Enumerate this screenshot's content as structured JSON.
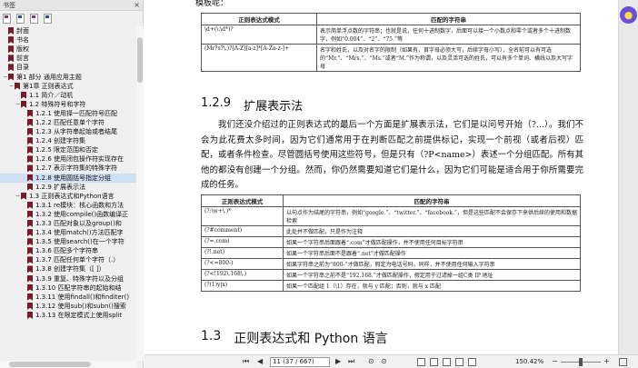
{
  "sidebar": {
    "title": "书签",
    "close": "×",
    "items": [
      {
        "label": "封面",
        "level": 0,
        "tw": ""
      },
      {
        "label": "书名",
        "level": 0,
        "tw": ""
      },
      {
        "label": "版权",
        "level": 0,
        "tw": ""
      },
      {
        "label": "前言",
        "level": 0,
        "tw": ""
      },
      {
        "label": "目录",
        "level": 0,
        "tw": ""
      },
      {
        "label": "第1 部分 通用应用主题",
        "level": 0,
        "tw": "−"
      },
      {
        "label": "第1章 正则表达式",
        "level": 1,
        "tw": "−"
      },
      {
        "label": "1.1 简介／动机",
        "level": 2,
        "tw": ""
      },
      {
        "label": "1.2 特殊符号和字符",
        "level": 2,
        "tw": "−"
      },
      {
        "label": "1.2.1 使用择一匹配符号匹配",
        "level": 3,
        "tw": ""
      },
      {
        "label": "1.2.2 匹配任意单个字符",
        "level": 3,
        "tw": ""
      },
      {
        "label": "1.2.3 从字符串起始或者结尾",
        "level": 3,
        "tw": ""
      },
      {
        "label": "1.2.4 创建字符集",
        "level": 3,
        "tw": ""
      },
      {
        "label": "1.2.5 限定范围和否定",
        "level": 3,
        "tw": ""
      },
      {
        "label": "1.2.6 使用闭包操作符实现存在",
        "level": 3,
        "tw": ""
      },
      {
        "label": "1.2.7 表示字符集的特殊字符",
        "level": 3,
        "tw": ""
      },
      {
        "label": "1.2.8 使用圆括号指定分组",
        "level": 3,
        "tw": "",
        "sel": true
      },
      {
        "label": "1.2.9 扩展表示法",
        "level": 3,
        "tw": ""
      },
      {
        "label": "1.3 正则表达式和Python语言",
        "level": 2,
        "tw": "−"
      },
      {
        "label": "1.3.1 re模块：核心函数和方法",
        "level": 3,
        "tw": ""
      },
      {
        "label": "1.3.2 使用compile()函数编译正",
        "level": 3,
        "tw": ""
      },
      {
        "label": "1.3.3 匹配对象以及group()和",
        "level": 3,
        "tw": ""
      },
      {
        "label": "1.3.4 使用match()方法匹配字",
        "level": 3,
        "tw": ""
      },
      {
        "label": "1.3.5 使用search()在一个字符",
        "level": 3,
        "tw": ""
      },
      {
        "label": "1.3.6 匹配多个字符串",
        "level": 3,
        "tw": ""
      },
      {
        "label": "1.3.7 匹配任何单个字符（.）",
        "level": 3,
        "tw": ""
      },
      {
        "label": "1.3.8 创建字符集（[ ]）",
        "level": 3,
        "tw": ""
      },
      {
        "label": "1.3.9 重复、特殊字符以及分组",
        "level": 3,
        "tw": ""
      },
      {
        "label": "1.3.10 匹配字符串的起始和结",
        "level": 3,
        "tw": ""
      },
      {
        "label": "1.3.11 使用findall()和finditer()",
        "level": 3,
        "tw": ""
      },
      {
        "label": "1.3.12 使用sub()和subn()搜索",
        "level": 3,
        "tw": ""
      },
      {
        "label": "1.3.13 在限定模式上使用split",
        "level": 3,
        "tw": ""
      }
    ]
  },
  "page": {
    "cut_text": "模板呢：",
    "table1": {
      "headers": [
        "正则表达式模式",
        "匹配的字符串"
      ],
      "rows": [
        [
          "\\d+(\\.\\d*)?",
          "表示简单浮点数的字符串；也就是说，任何十进制数字，后面可以接一个小数点和零个或者多个十进制数字，例如“0.004”、“2”、“75.”等"
        ],
        [
          "(Mr?s?\\.)?[A-Z][a-z]*[A-Za-z-]+",
          "名字和姓氏，以及对名字的限制（如果有，首字母必须大写，后续字母小写），全名前可以有可选的“Mr.”、“Mrs.”、“Ms.”或者“M.”作为称谓，以及灵活可选的姓氏，可以有多个单词、横线以及大写字母"
        ]
      ]
    },
    "section1": {
      "num": "1.2.9",
      "title": "扩展表示法"
    },
    "paragraph": "我们还没介绍过的正则表达式的最后一个方面是扩展表示法，它们是以问号开始（?...）。我们不会为此花费太多时间，因为它们通常用于在判断匹配之前提供标记，实现一个前视（或者后视）匹配，或者条件检查。尽管圆括号使用这些符号，但是只有（?P<name>）表述一个分组匹配。所有其他的都没有创建一个分组。然而，你仍然需要知道它们是什么，因为它们可能是适合用于你所需要完成的任务。",
    "table2": {
      "headers": [
        "正则表达式模式",
        "匹配的字符串"
      ],
      "rows": [
        [
          "(?:\\w+\\.)*",
          "以句点作为结尾的字符串，例如“google.”、“twitter.”、“facebook.”，但是这些匹配不会保存下来供后续的使用和数据检索"
        ],
        [
          "(?#comment)",
          "此处并不做匹配，只是作为注释"
        ],
        [
          "(?=.com)",
          "如果一个字符串后面跟着“.com”才做匹配操作，并不使用任何目标字符串"
        ],
        [
          "(?!.net)",
          "如果一个字符串后面不是跟着“.net”才做匹配操作"
        ],
        [
          "(?<=800-)",
          "如果字符串之前为“800-”才做匹配，假定为电话号码，同样，并不使用任何输入字符串"
        ],
        [
          "(?<!192\\.168\\.)",
          "如果一个字符串之前不是“192.168.”才做匹配操作，假定用于过滤掉一组C类 IP 地址"
        ],
        [
          "(?(1)y|x)",
          "如果一个匹配组 1（\\1）存在，就与 y 匹配；否则，就与 x 匹配"
        ]
      ]
    },
    "section2": {
      "num": "1.3",
      "title": "正则表达式和 Python 语言"
    }
  },
  "bottombar": {
    "first": "⏮",
    "prev": "◀",
    "next": "▶",
    "last": "⏭",
    "page_value": "11 (37 / 667)",
    "back": "⊙",
    "forward": "⊙",
    "zoom": "150.42%",
    "zoom_minus": "−",
    "zoom_plus": "+"
  },
  "colors": {
    "accent": "#6a4fd8",
    "bookmark": "#7a1a2a",
    "selection": "#cfe0f4"
  }
}
